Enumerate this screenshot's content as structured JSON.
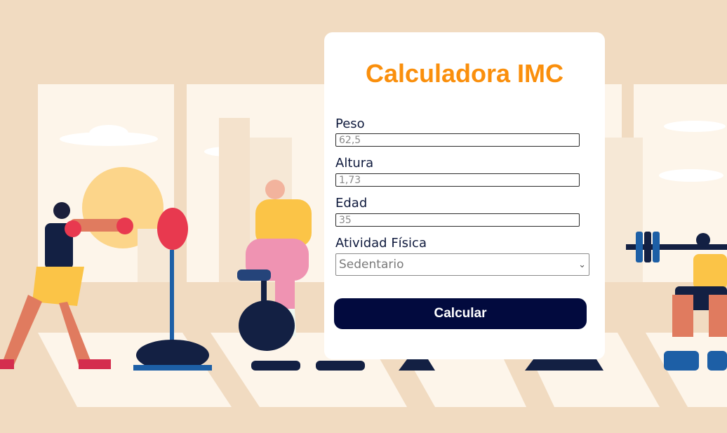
{
  "app": {
    "title": "Calculadora IMC"
  },
  "form": {
    "peso": {
      "label": "Peso",
      "placeholder": "62,5"
    },
    "altura": {
      "label": "Altura",
      "placeholder": "1,73"
    },
    "edad": {
      "label": "Edad",
      "placeholder": "35"
    },
    "actividad": {
      "label": "Atividad Física",
      "selected": "Sedentario"
    },
    "submit_label": "Calcular"
  },
  "colors": {
    "background": "#f1dbc1",
    "title": "#fa8f0c",
    "button": "#020a3e",
    "label": "#0f1a3d"
  },
  "icons": {
    "select_caret": "chevron-down-icon"
  }
}
